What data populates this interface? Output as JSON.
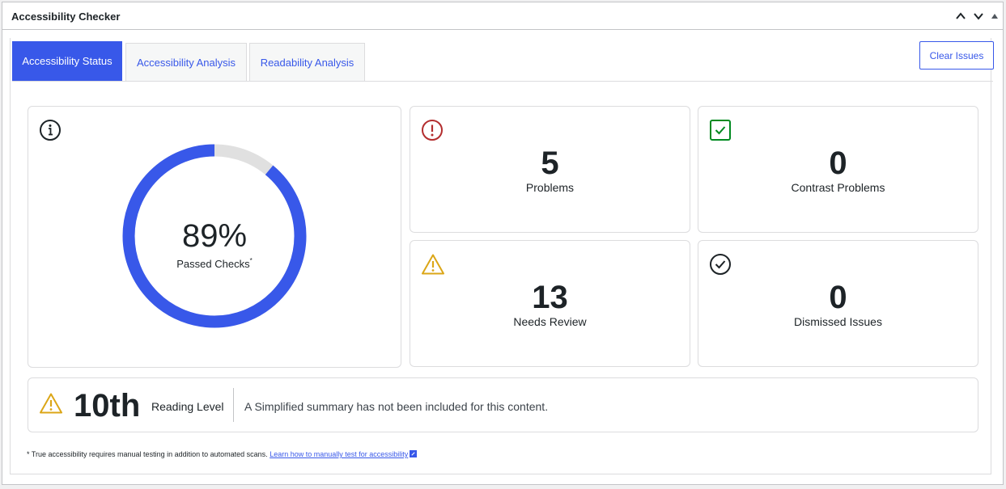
{
  "panel": {
    "title": "Accessibility Checker",
    "controls": [
      "chevron-up-icon",
      "chevron-down-icon",
      "triangle-up-icon"
    ]
  },
  "tabs": [
    {
      "label": "Accessibility Status",
      "active": true
    },
    {
      "label": "Accessibility Analysis",
      "active": false
    },
    {
      "label": "Readability Analysis",
      "active": false
    }
  ],
  "clear_button": "Clear Issues",
  "summary": {
    "passed_percent": "89%",
    "passed_value": 0.89,
    "passed_label": "Passed Checks",
    "passed_mark": "*",
    "icon": "info-icon"
  },
  "stats": {
    "problems": {
      "value": "5",
      "label": "Problems",
      "icon": "error-icon",
      "color": "#b32d2e"
    },
    "contrast": {
      "value": "0",
      "label": "Contrast Problems",
      "icon": "checkbox-icon",
      "color": "#008a20"
    },
    "review": {
      "value": "13",
      "label": "Needs Review",
      "icon": "warning-icon",
      "color": "#dba617"
    },
    "dismissed": {
      "value": "0",
      "label": "Dismissed Issues",
      "icon": "check-circle-icon",
      "color": "#1d2327"
    }
  },
  "readability": {
    "level": "10th",
    "label": "Reading Level",
    "summary": "A Simplified summary has not been included for this content.",
    "icon": "warning-icon"
  },
  "footnote": {
    "text": "* True accessibility requires manual testing in addition to automated scans.",
    "link": "Learn how to manually test for accessibility"
  },
  "colors": {
    "accent": "#3858e9",
    "track": "#e0e0e0"
  }
}
